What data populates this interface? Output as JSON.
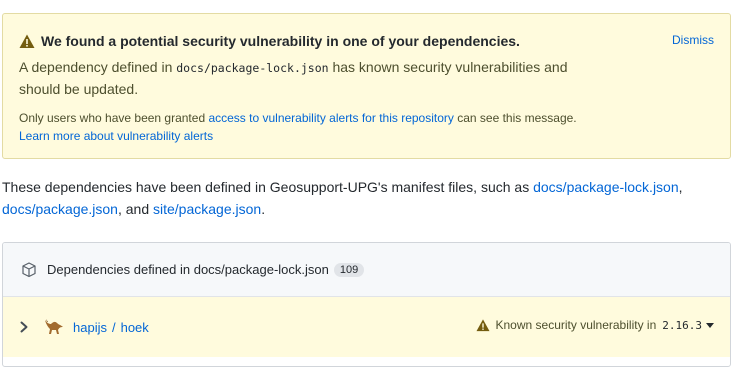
{
  "alert": {
    "title": "We found a potential security vulnerability in one of your dependencies.",
    "dismiss_label": "Dismiss",
    "body_prefix": "A dependency defined in ",
    "body_file": "docs/package-lock.json",
    "body_suffix": " has known security vulnerabilities and should be updated.",
    "note_prefix": "Only users who have been granted ",
    "note_link": "access to vulnerability alerts for this repository",
    "note_suffix": " can see this message.",
    "learn_more": "Learn more about vulnerability alerts"
  },
  "intro": {
    "prefix": "These dependencies have been defined in Geosupport-UPG's manifest files, such as ",
    "link1": "docs/package-lock.json",
    "sep1": ", ",
    "link2": "docs/package.json",
    "sep2": ", and ",
    "link3": "site/package.json",
    "suffix": "."
  },
  "dependencies": {
    "header_label": "Dependencies defined in docs/package-lock.json",
    "count": "109",
    "rows": [
      {
        "owner": "hapijs",
        "separator": "/",
        "repo": "hoek",
        "alert_text": "Known security vulnerability in",
        "version": "2.16.3"
      }
    ]
  },
  "icons": {
    "warning": "alert-icon",
    "package": "package-icon",
    "chevron": "chevron-right-icon",
    "logo": "hapi-logo-icon",
    "caret": "triangle-down-icon"
  },
  "colors": {
    "alert_bg": "#fffbdd",
    "link": "#0366d6",
    "warning_icon": "#735c0f"
  }
}
